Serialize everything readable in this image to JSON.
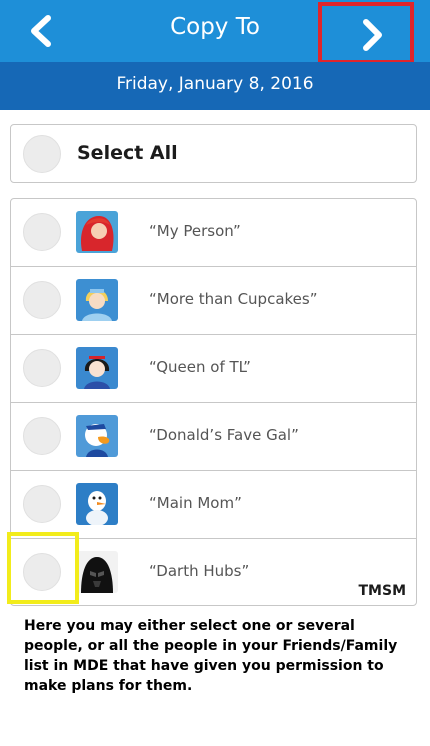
{
  "header": {
    "title": "Copy To",
    "date": "Friday, January 8, 2016",
    "back_icon": "chevron-left-icon",
    "next_icon": "chevron-right-icon"
  },
  "select_all": {
    "label": "Select All"
  },
  "people": [
    {
      "name": "“My Person”",
      "avatar": "ariel-avatar"
    },
    {
      "name": "“More than Cupcakes”",
      "avatar": "cinderella-avatar"
    },
    {
      "name": "“Queen of TL”",
      "avatar": "snow-white-avatar"
    },
    {
      "name": "“Donald’s Fave Gal”",
      "avatar": "donald-duck-avatar"
    },
    {
      "name": "“Main Mom”",
      "avatar": "olaf-avatar"
    },
    {
      "name": "“Darth Hubs”",
      "avatar": "darth-vader-avatar"
    }
  ],
  "watermark": "TMSM",
  "instructions": "Here you may either select one or several people, or all the people in your Friends/Family list in MDE that have given you permission to make plans for them.",
  "colors": {
    "header": "#1e8fd8",
    "subheader": "#1668b6",
    "next_highlight": "#e0252b",
    "row_highlight": "#f2ec1b"
  }
}
